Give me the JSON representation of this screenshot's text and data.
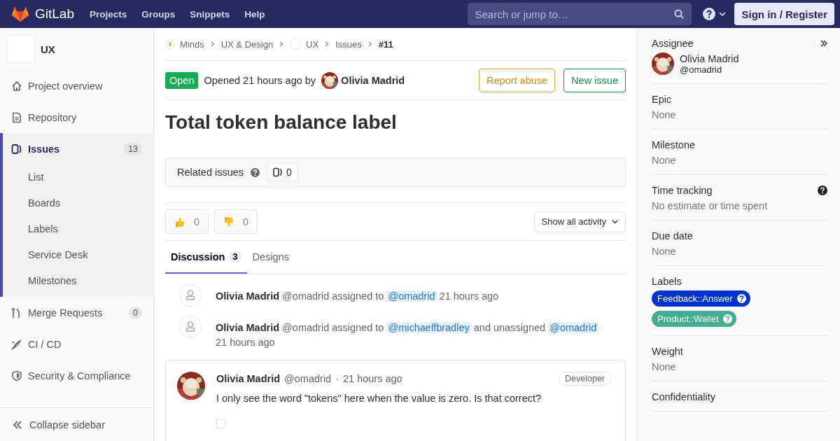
{
  "header": {
    "logo_text": "GitLab",
    "nav": [
      "Projects",
      "Groups",
      "Snippets",
      "Help"
    ],
    "search": {
      "placeholder": "Search or jump to…"
    },
    "sign_in": "Sign in / Register"
  },
  "sidebar": {
    "project": "UX",
    "items": [
      {
        "label": "Project overview",
        "selected": false
      },
      {
        "label": "Repository",
        "selected": false
      },
      {
        "label": "Issues",
        "selected": true,
        "count": "13",
        "children": [
          {
            "label": "List"
          },
          {
            "label": "Boards"
          },
          {
            "label": "Labels"
          },
          {
            "label": "Service Desk"
          },
          {
            "label": "Milestones"
          }
        ]
      },
      {
        "label": "Merge Requests",
        "selected": false,
        "count": "0"
      },
      {
        "label": "CI / CD",
        "selected": false
      },
      {
        "label": "Security & Compliance",
        "selected": false
      }
    ],
    "collapse": "Collapse sidebar"
  },
  "breadcrumbs": [
    {
      "label": "Minds",
      "kind": "group"
    },
    {
      "label": "UX & Design",
      "kind": "plain"
    },
    {
      "label": "UX",
      "kind": "project"
    },
    {
      "label": "Issues",
      "kind": "plain"
    },
    {
      "label": "#11",
      "kind": "current"
    }
  ],
  "issue": {
    "status": "Open",
    "opened": "Opened 21 hours ago by",
    "author": "Olivia Madrid",
    "buttons": [
      {
        "label": "Report abuse",
        "kind": "warning"
      },
      {
        "label": "New issue",
        "kind": "success"
      }
    ],
    "title": "Total token balance label"
  },
  "related": {
    "label": "Related issues",
    "count": "0"
  },
  "reactions": [
    {
      "kind": "thumbsup",
      "count": "0"
    },
    {
      "kind": "thumbsdown",
      "count": "0"
    }
  ],
  "activity_filter": "Show all activity",
  "tabs": [
    {
      "label": "Discussion",
      "count": "3",
      "selected": true
    },
    {
      "label": "Designs",
      "selected": false
    }
  ],
  "notes": [
    {
      "kind": "system",
      "author": "Olivia Madrid",
      "segments": [
        {
          "kind": "text",
          "text": "@omadrid assigned to"
        },
        {
          "kind": "mention",
          "text": "@omadrid"
        }
      ],
      "time": "21 hours ago"
    },
    {
      "kind": "system",
      "author": "Olivia Madrid",
      "segments": [
        {
          "kind": "text",
          "text": "@omadrid assigned to"
        },
        {
          "kind": "mention",
          "text": "@michaelfbradley"
        },
        {
          "kind": "text",
          "text": "and unassigned"
        },
        {
          "kind": "mention",
          "text": "@omadrid"
        }
      ],
      "time": "21 hours ago"
    },
    {
      "kind": "comment",
      "author": "Olivia Madrid",
      "username": "@omadrid",
      "separator": "·",
      "time": "21 hours ago",
      "role": "Developer",
      "body": "I only see the word \"tokens\" here when the value is zero. Is that correct?",
      "task_checked": false
    }
  ],
  "right_sidebar": [
    {
      "kind": "assignee",
      "label": "Assignee",
      "name": "Olivia Madrid",
      "username": "@omadrid"
    },
    {
      "kind": "text",
      "label": "Epic",
      "value": "None"
    },
    {
      "kind": "text",
      "label": "Milestone",
      "value": "None"
    },
    {
      "kind": "text",
      "label": "Time tracking",
      "value": "No estimate or time spent",
      "help": true
    },
    {
      "kind": "text",
      "label": "Due date",
      "value": "None"
    },
    {
      "kind": "labels",
      "label": "Labels",
      "labels": [
        {
          "text": "Feedback::Answer",
          "color": "#0033cc"
        },
        {
          "text": "Product::Wallet",
          "color": "#44ad8e"
        }
      ]
    },
    {
      "kind": "text",
      "label": "Weight",
      "value": "None"
    },
    {
      "kind": "text",
      "label": "Confidentiality"
    }
  ]
}
